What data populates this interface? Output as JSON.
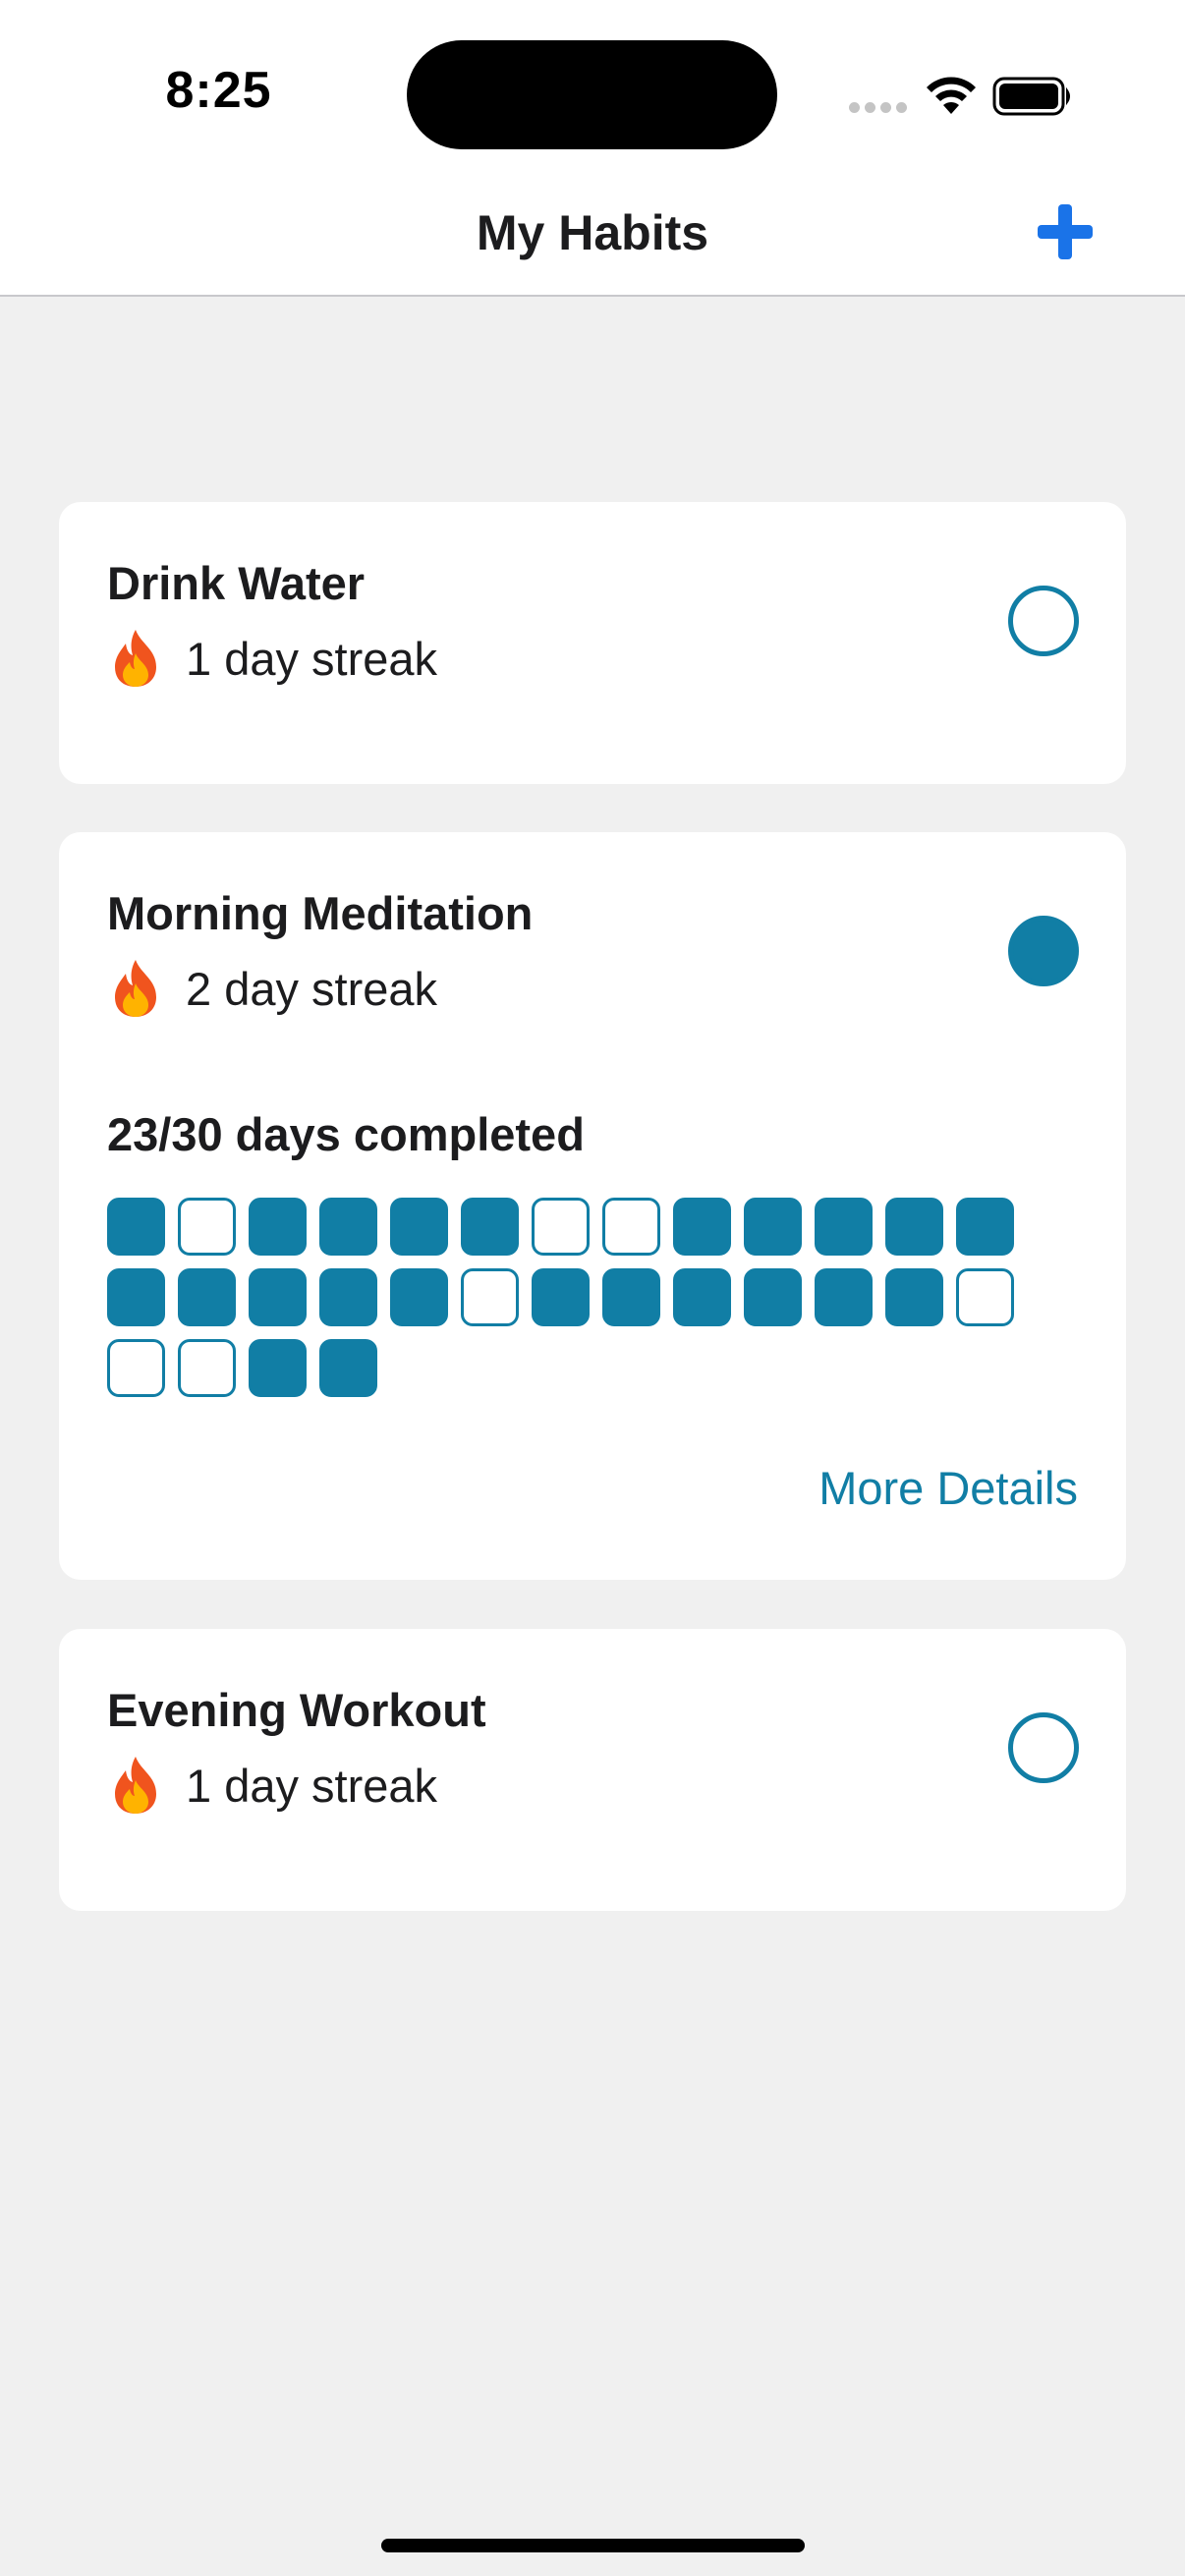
{
  "status_bar": {
    "time": "8:25"
  },
  "nav": {
    "title": "My Habits",
    "add_icon": "plus-icon",
    "accent_color": "#1a73e8"
  },
  "theme": {
    "habit_color": "#117ea5",
    "background": "#f0f0f0"
  },
  "habits": [
    {
      "name": "Drink Water",
      "streak": "1 day streak",
      "completed_today": false
    },
    {
      "name": "Morning Meditation",
      "streak": "2 day streak",
      "completed_today": true,
      "progress_label": "23/30 days completed",
      "days": [
        1,
        0,
        1,
        1,
        1,
        1,
        0,
        0,
        1,
        1,
        1,
        1,
        1,
        1,
        1,
        1,
        1,
        1,
        0,
        1,
        1,
        1,
        1,
        1,
        1,
        0,
        0,
        0,
        1,
        1
      ],
      "more_details_label": "More Details"
    },
    {
      "name": "Evening Workout",
      "streak": "1 day streak",
      "completed_today": false
    }
  ]
}
